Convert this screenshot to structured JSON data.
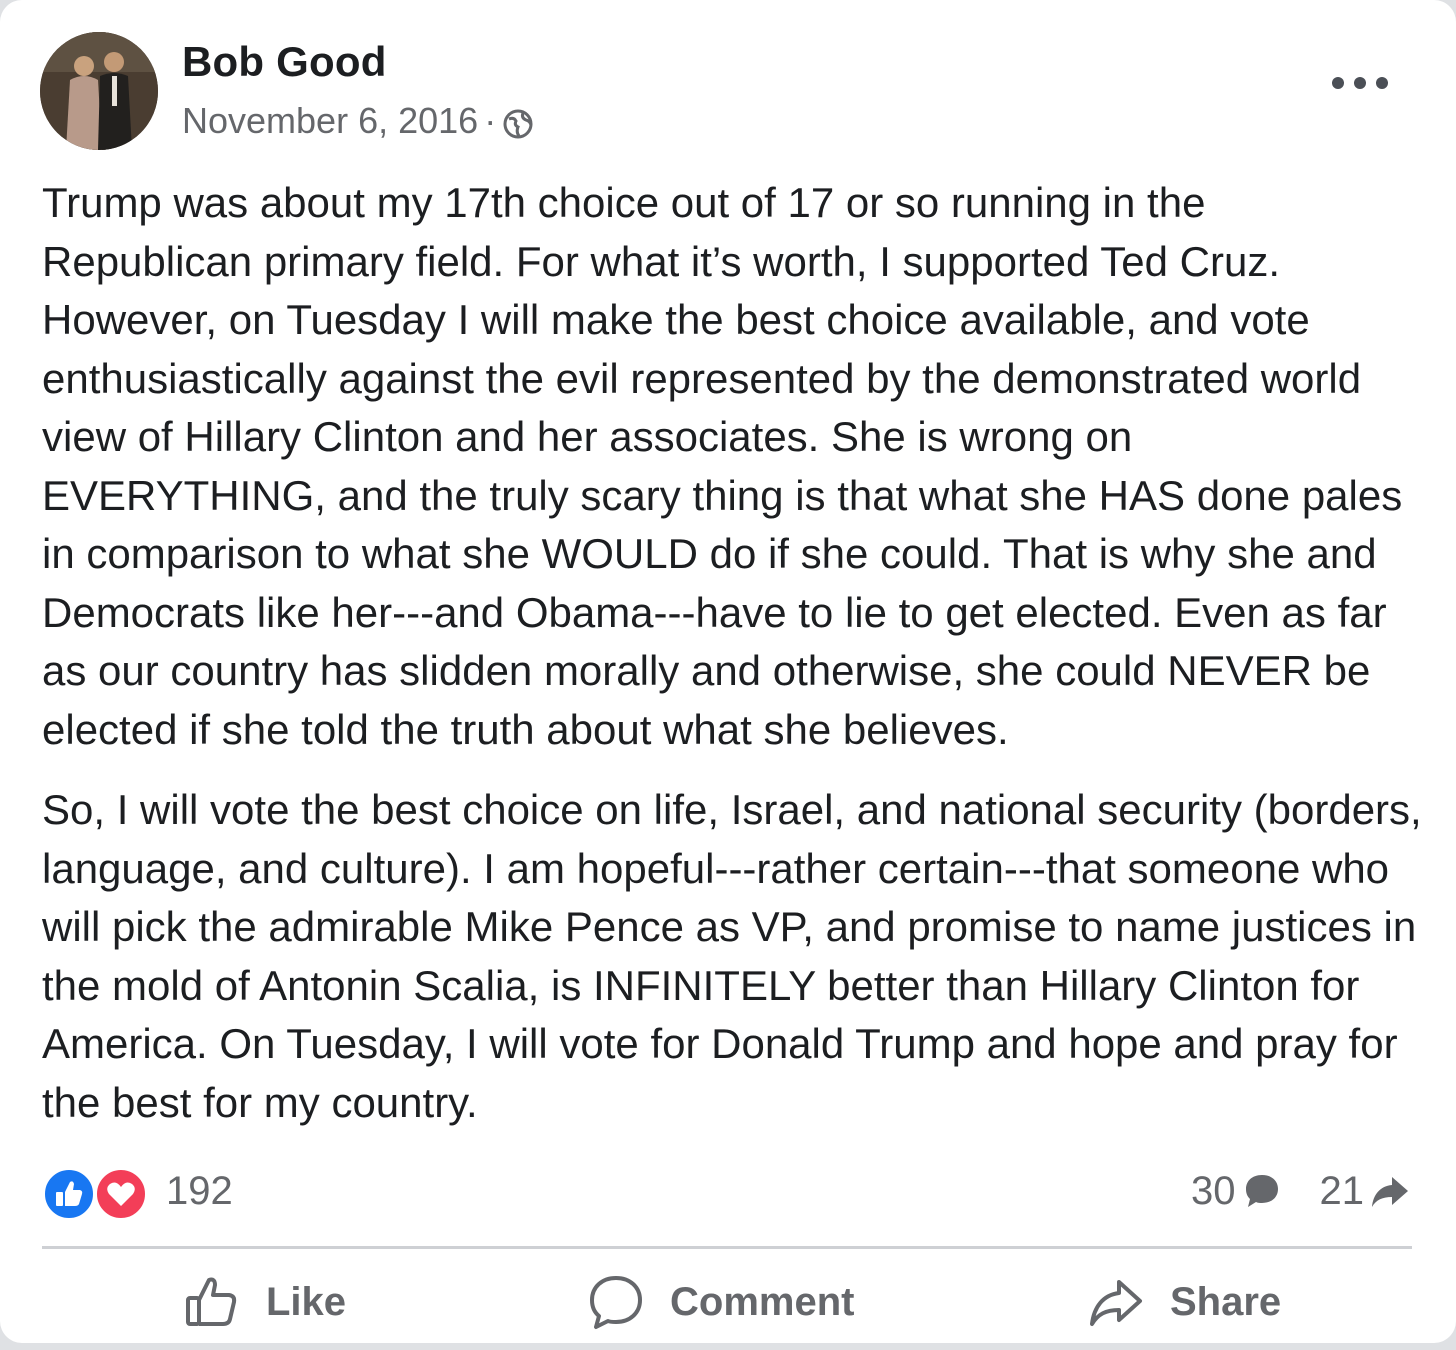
{
  "post": {
    "author": "Bob Good",
    "date": "November 6, 2016",
    "separator": "·",
    "privacy_icon": "globe-icon",
    "more_icon": "more-options-icon",
    "paragraphs": [
      "Trump was about my 17th choice out of 17 or so running in the Republican primary field.  For what it’s worth, I supported Ted Cruz. However, on Tuesday I will make the best choice available, and vote enthusiastically against the evil represented by the demonstrated world view of Hillary Clinton and her associates.  She is wrong on EVERYTHING, and the truly scary thing is that what she HAS done pales in comparison to what she WOULD do if she could.  That is why she and Democrats like her---and Obama---have to lie to get elected. Even as far as our country has slidden morally and otherwise, she could NEVER be elected if she told the truth about what she believes.",
      "So, I will vote the best choice on life, Israel, and national security (borders, language, and culture).  I am hopeful---rather certain---that someone who will pick the admirable Mike Pence as VP, and promise to name justices in the mold of Antonin Scalia, is INFINITELY better than Hillary Clinton for America.  On Tuesday, I will vote for Donald Trump and hope and pray for the best for my country."
    ]
  },
  "stats": {
    "reaction_count": "192",
    "reaction_icons": [
      "like-reaction-icon",
      "love-reaction-icon"
    ],
    "comment_count": "30",
    "share_count": "21"
  },
  "actions": {
    "like_label": "Like",
    "comment_label": "Comment",
    "share_label": "Share"
  },
  "colors": {
    "like_blue": "#1877f2",
    "love_red": "#f33e58",
    "secondary_text": "#65676b",
    "primary_text": "#1c1e21"
  }
}
